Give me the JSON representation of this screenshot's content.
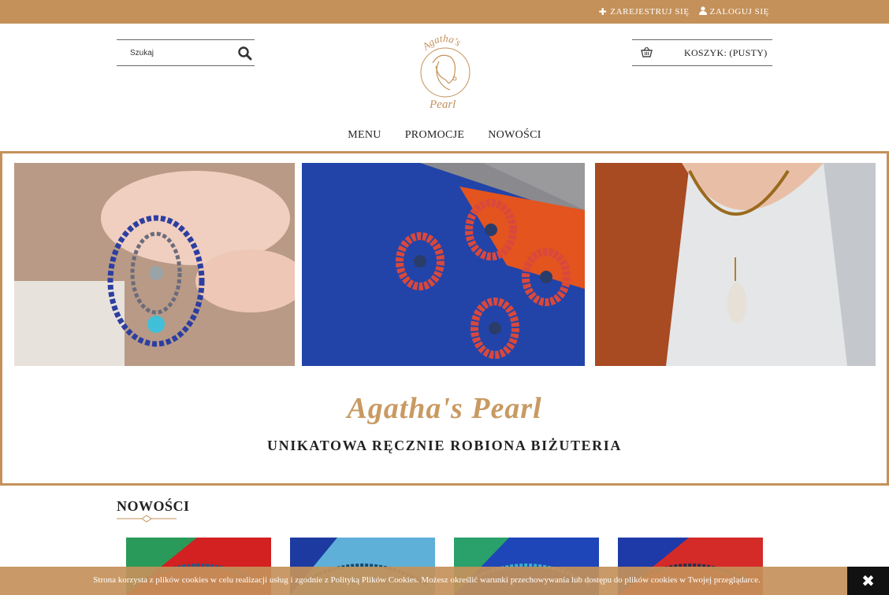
{
  "topbar": {
    "register": "ZAREJESTRUJ SIĘ",
    "login": "ZALOGUJ SIĘ",
    "register_icon": "plus-icon",
    "login_icon": "user-icon",
    "color": "#c4915a"
  },
  "header": {
    "search_placeholder": "Szukaj",
    "search_icon": "search-icon",
    "logo_line1": "Agatha's",
    "logo_line2": "Pearl",
    "cart_label": "KOSZYK: (PUSTY)",
    "cart_icon": "basket-icon"
  },
  "nav": {
    "items": [
      "MENU",
      "PROMOCJE",
      "NOWOŚCI"
    ]
  },
  "banner": {
    "brand": "Agatha's Pearl",
    "tagline": "UNIKATOWA RĘCZNIE ROBIONA BIŻUTERIA"
  },
  "section": {
    "title": "NOWOŚCI"
  },
  "cookie": {
    "message": "Strona korzysta z plików cookies w celu realizacji usług i zgodnie z Polityką Plików Cookies. Możesz określić warunki przechowywania lub dostępu do plików cookies w Twojej przeglądarce.",
    "close_icon": "close-icon"
  }
}
